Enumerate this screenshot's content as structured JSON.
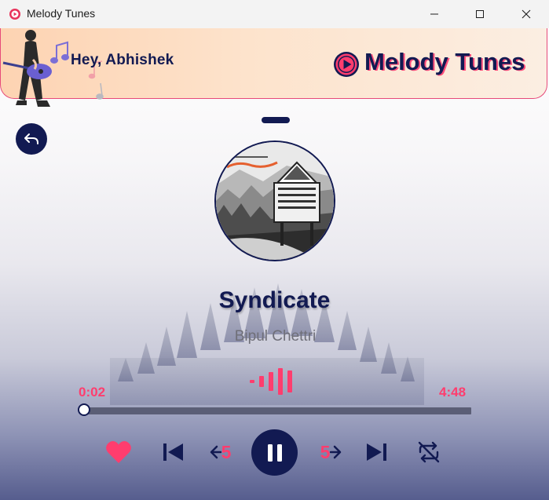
{
  "window": {
    "title": "Melody Tunes",
    "controls": [
      "minimize",
      "maximize",
      "close"
    ]
  },
  "header": {
    "greeting": "Hey, Abhishek",
    "brand_name": "Melody Tunes",
    "brand_icon": "play-circle-icon",
    "illustration": "guitarist-with-music-notes"
  },
  "navigation": {
    "back_icon": "back-arrow-icon"
  },
  "now_playing": {
    "title": "Syndicate",
    "artist": "Bipul Chettri",
    "album_art": "syndicate-album-cover",
    "current_time": "0:02",
    "total_time": "4:48",
    "progress_fraction": 0.007
  },
  "controls": {
    "favorite_icon": "heart-icon",
    "previous_icon": "skip-previous-icon",
    "rewind_label": "5",
    "rewind_icon": "rewind-arrow-icon",
    "play_pause_icon": "pause-icon",
    "forward_label": "5",
    "forward_icon": "forward-arrow-icon",
    "next_icon": "skip-next-icon",
    "repeat_icon": "repeat-off-icon"
  },
  "colors": {
    "primary": "#121a52",
    "accent": "#ff3d6e",
    "header_from": "#fdd3b2",
    "header_to": "#fbeee2"
  }
}
